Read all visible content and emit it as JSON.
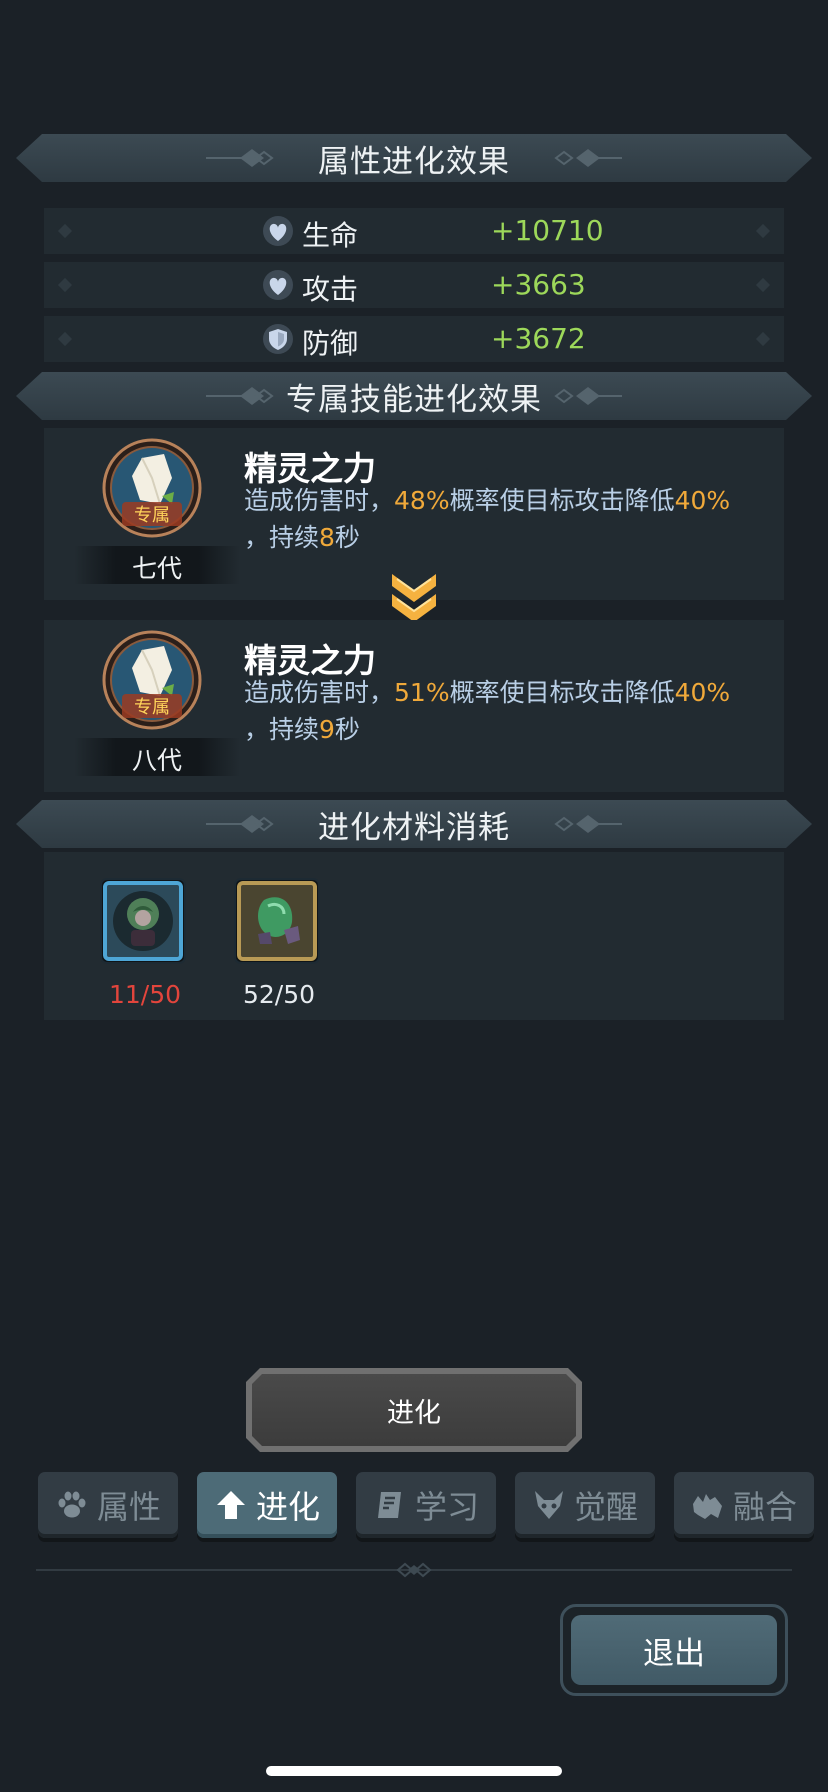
{
  "attribute_section": {
    "title": "属性进化效果",
    "stats": [
      {
        "label": "生命",
        "value": "+10710",
        "icon": "heart-icon"
      },
      {
        "label": "攻击",
        "value": "+3663",
        "icon": "heart-icon"
      },
      {
        "label": "防御",
        "value": "+3672",
        "icon": "shield-icon"
      }
    ]
  },
  "skill_section": {
    "title": "专属技能进化效果",
    "skills": [
      {
        "name": "精灵之力",
        "badge": "专属",
        "generation": "七代",
        "desc_1": "造成伤害时，",
        "chance": "48%",
        "desc_2": "概率使目标攻击降低",
        "reduction": "40%",
        "desc_3": "，持续",
        "duration": "8",
        "desc_4": "秒"
      },
      {
        "name": "精灵之力",
        "badge": "专属",
        "generation": "八代",
        "desc_1": "造成伤害时，",
        "chance": "51%",
        "desc_2": "概率使目标攻击降低",
        "reduction": "40%",
        "desc_3": "，持续",
        "duration": "9",
        "desc_4": "秒"
      }
    ]
  },
  "materials_section": {
    "title": "进化材料消耗",
    "items": [
      {
        "count": "11/50",
        "count_color": "#e2453c",
        "icon": "character-shard-icon",
        "frame_color": "#4ea6d6"
      },
      {
        "count": "52/50",
        "count_color": "#e6ebef",
        "icon": "green-gem-icon",
        "frame_color": "#b89a55"
      }
    ]
  },
  "evolve_button": {
    "label": "进化"
  },
  "tabs": [
    {
      "label": "属性",
      "icon": "paw-icon",
      "active": false
    },
    {
      "label": "进化",
      "icon": "arrow-up-icon",
      "active": true
    },
    {
      "label": "学习",
      "icon": "book-icon",
      "active": false
    },
    {
      "label": "觉醒",
      "icon": "horned-mask-icon",
      "active": false
    },
    {
      "label": "融合",
      "icon": "fusion-icon",
      "active": false
    }
  ],
  "exit_button": {
    "label": "退出"
  },
  "colors": {
    "stat_value": "#9dd85a",
    "highlight": "#f0a93a",
    "desc": "#b9cfe6",
    "background": "#1b2127"
  }
}
